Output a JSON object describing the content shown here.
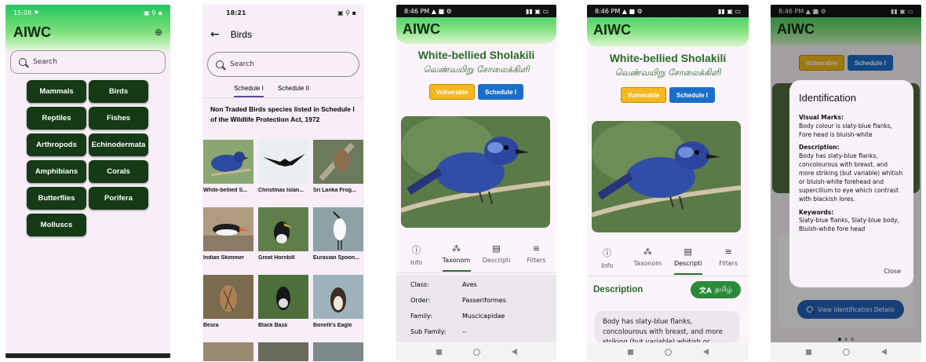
{
  "screen1": {
    "status_time": "15:08 ⚑",
    "app_title": "AIWC",
    "search_placeholder": "Search",
    "categories": [
      "Mammals",
      "Birds",
      "Reptiles",
      "Fishes",
      "Arthropods",
      "Echinodermata",
      "Amphibians",
      "Corals",
      "Butterflies",
      "Porifera",
      "Molluscs"
    ]
  },
  "screen2": {
    "status_time": "18:21",
    "page_title": "Birds",
    "search_placeholder": "Search",
    "tabs": [
      "Schedule I",
      "Schedule II"
    ],
    "heading": "Non Traded Birds species listed in Schedule I of the Wildlife Protection Act, 1972",
    "birds": [
      "White-bellied S...",
      "Christmas Islan...",
      "Sri Lanka Frog...",
      "Indian Skimmer",
      "Great Hornbill",
      "Eurasian Spoon...",
      "Besra",
      "Black Baza",
      "Bonelli's Eagle"
    ]
  },
  "screen3": {
    "status_time": "8:46 PM ▲ ■ ⚙",
    "app_title": "AIWC",
    "name_en": "White-bellied Sholakili",
    "name_ta": "வெண்வயிறு சோலைக்கிளி",
    "badge_status": "Vulnerable",
    "badge_schedule": "Schedule I",
    "tabs": [
      "Info",
      "Taxonom",
      "Descripti",
      "Filters"
    ],
    "taxonomy": [
      {
        "key": "Class:",
        "val": "Aves"
      },
      {
        "key": "Order:",
        "val": "Passeriformes"
      },
      {
        "key": "Family:",
        "val": "Muscicapidae"
      },
      {
        "key": "Sub Family:",
        "val": "--"
      }
    ]
  },
  "screen4": {
    "status_time": "8:46 PM ▲ ■ ⚙",
    "app_title": "AIWC",
    "name_en": "White-bellied Sholakili",
    "name_ta": "வெண்வயிறு சோலைக்கிளி",
    "badge_status": "Vulnerable",
    "badge_schedule": "Schedule I",
    "tabs": [
      "Info",
      "Taxonom",
      "Descripti",
      "Filters"
    ],
    "section_title": "Description",
    "lang_button": "தமிழ்",
    "description": "Body has slaty-blue flanks, concolourous with breast, and more striking (but variable) whitish or bluish"
  },
  "screen5": {
    "status_time": "8:46 PM ▲ ■ ⚙",
    "app_title": "AIWC",
    "badge_status": "Vulnerable",
    "badge_schedule": "Schedule I",
    "dialog_title": "Identification",
    "visual_marks_label": "Visual Marks:",
    "visual_marks": "Body colour is slaty-blue flanks, Fore head is bluish-white",
    "description_label": "Description:",
    "description": "Body has slaty-blue flanks, concolourous with breast, and more striking (but variable) whitish or bluish-white forehead and supercilium to eye which contrast with blackish lores.",
    "keywords_label": "Keywords:",
    "keywords": "Slaty-blue flanks, Slaty-blue body, Bluish-white fore head",
    "close_label": "Close",
    "view_button": "View Identification Details"
  },
  "colors": {
    "green_dark": "#143a16",
    "accent": "#22c55e",
    "vulnerable": "#f5b81f",
    "schedule": "#1b6fc9",
    "title_green": "#2a6a2a"
  }
}
